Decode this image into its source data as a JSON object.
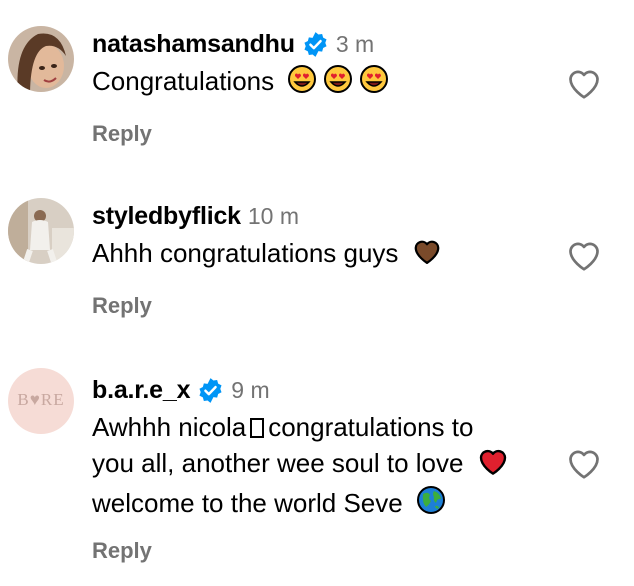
{
  "comments": [
    {
      "username": "natashamsandhu",
      "verified": true,
      "time": "3 m",
      "text": "Congratulations",
      "emojis": [
        "heart-eyes-face",
        "heart-eyes-face",
        "heart-eyes-face"
      ],
      "reply_label": "Reply"
    },
    {
      "username": "styledbyflick",
      "verified": false,
      "time": "10 m",
      "text": "Ahhh congratulations guys",
      "emojis": [
        "brown-heart"
      ],
      "reply_label": "Reply"
    },
    {
      "username": "b.a.r.e_x",
      "verified": true,
      "time": "9 m",
      "avatar_text": "B♥RE",
      "text_line1_a": "Awhhh nicola",
      "text_line1_b": "congratulations to",
      "text_line2": "you all, another wee soul to love",
      "text_line3": "welcome to the world Seve",
      "emojis": [
        "red-heart",
        "globe"
      ],
      "reply_label": "Reply"
    }
  ],
  "colors": {
    "verified_blue": "#0095f6",
    "secondary_text": "#737373",
    "red_heart": "#e0202e",
    "brown_heart": "#7a4a2a",
    "emoji_yellow": "#ffc83d"
  }
}
